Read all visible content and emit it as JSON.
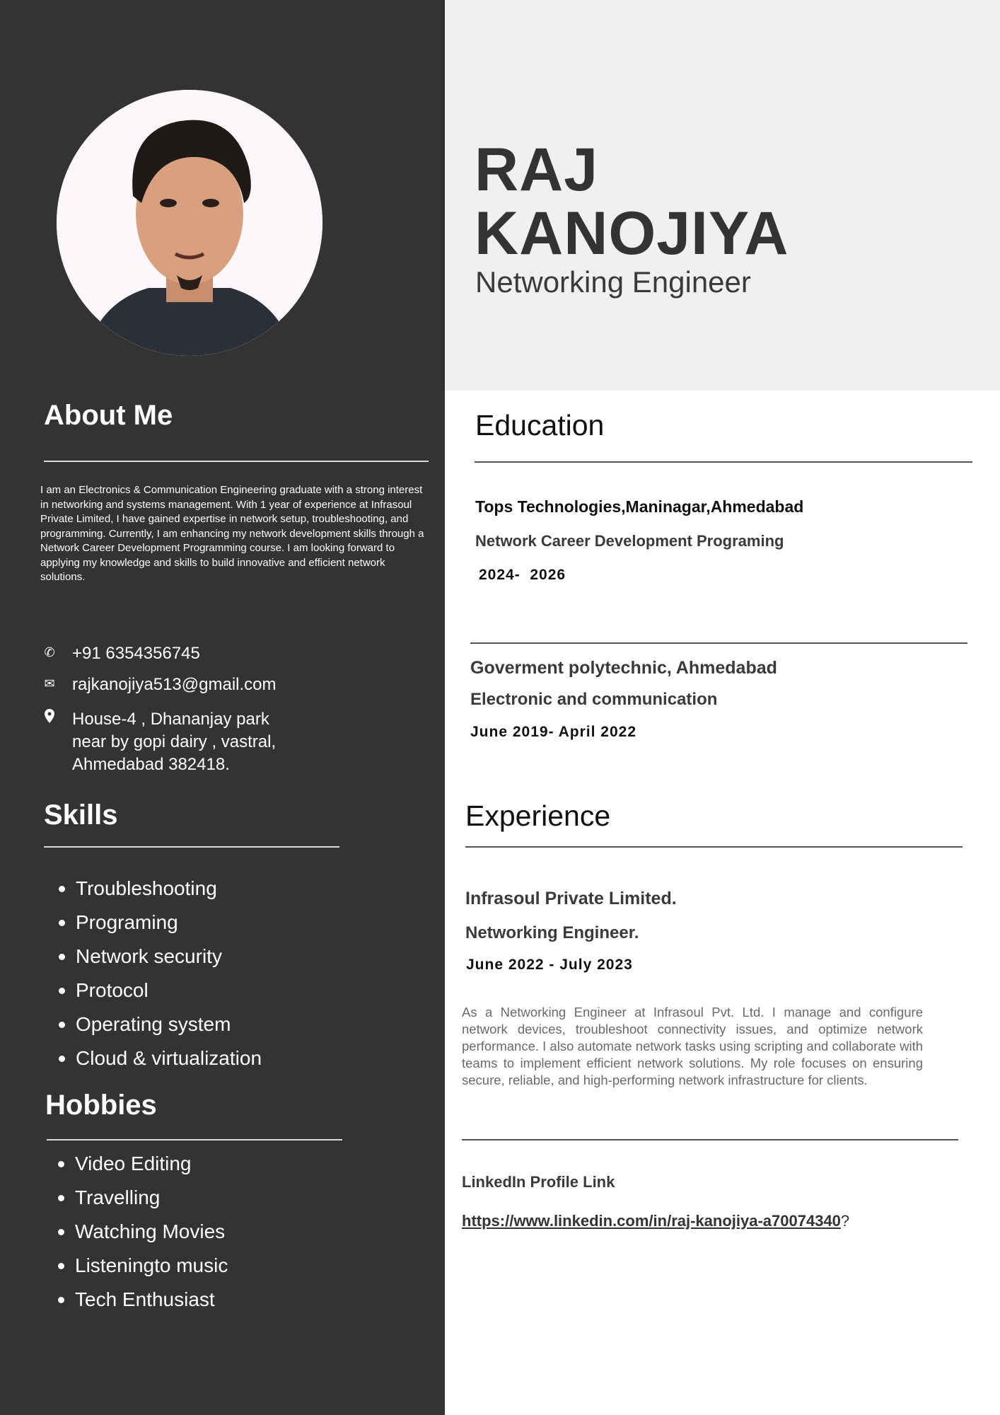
{
  "header": {
    "first_name": "RAJ",
    "last_name": "KANOJIYA",
    "title": "Networking Engineer"
  },
  "about": {
    "heading": "About Me",
    "text": "I am an Electronics & Communication Engineering graduate with a strong interest in networking and systems management. With 1 year of experience at Infrasoul Private Limited, I have gained expertise in network setup, troubleshooting, and programming. Currently, I am enhancing my network development skills through a Network Career Development Programming course. I am looking forward to applying my knowledge and skills to build innovative and efficient network solutions."
  },
  "contact": {
    "phone": "+91 6354356745",
    "email": "rajkanojiya513@gmail.com",
    "address_line1": "House-4 , Dhananjay park",
    "address_line2": "near by gopi dairy , vastral,",
    "address_line3": "Ahmedabad 382418.",
    "icons": [
      "phone-icon",
      "mail-icon",
      "location-pin-icon"
    ]
  },
  "skills": {
    "heading": "Skills",
    "items": [
      "Troubleshooting",
      "Programing",
      "Network security",
      "Protocol",
      "Operating system",
      "Cloud & virtualization"
    ]
  },
  "hobbies": {
    "heading": "Hobbies",
    "items": [
      "Video Editing",
      "Travelling",
      "Watching Movies",
      "Listeningto music",
      "Tech Enthusiast"
    ]
  },
  "education": {
    "heading": "Education",
    "entries": [
      {
        "institution": "Tops Technologies,Maninagar,Ahmedabad",
        "course": "Network Career Development Programing",
        "dates": "2024-  2026"
      },
      {
        "institution": "Goverment polytechnic, Ahmedabad",
        "course": "Electronic and communication",
        "dates": "June 2019- April 2022"
      }
    ]
  },
  "experience": {
    "heading": "Experience",
    "company": "Infrasoul Private Limited.",
    "position": "Networking Engineer.",
    "dates": "June 2022 - July 2023",
    "description": "As a Networking Engineer at Infrasoul Pvt. Ltd. I manage and configure network devices, troubleshoot connectivity issues, and optimize network performance. I also automate network tasks using scripting and collaborate with teams to implement efficient network solutions. My role focuses on ensuring secure, reliable, and high-performing network infrastructure for clients."
  },
  "linkedin": {
    "label": "LinkedIn Profile Link",
    "url": "https://www.linkedin.com/in/raj-kanojiya-a70074340",
    "suffix": "?"
  },
  "colors": {
    "sidebar": "#333333",
    "top_band": "#f0f0f0",
    "text_dark": "#111111",
    "text_gray": "#3a3a3a",
    "white": "#ffffff"
  }
}
